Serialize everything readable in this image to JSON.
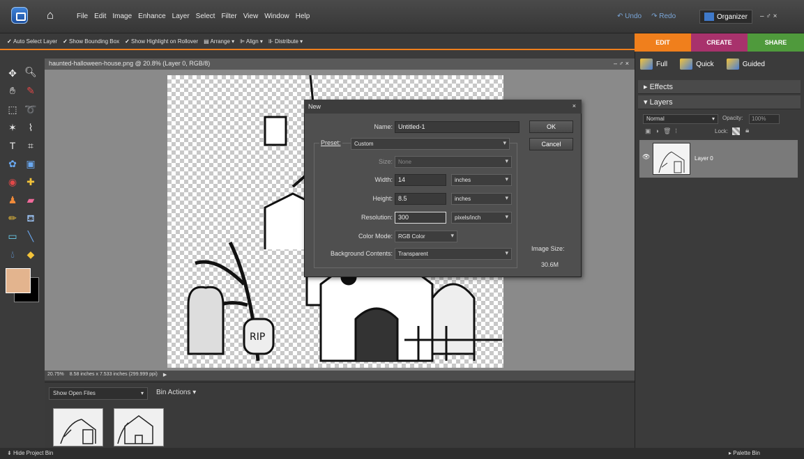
{
  "menubar": {
    "items": [
      "File",
      "Edit",
      "Image",
      "Enhance",
      "Layer",
      "Select",
      "Filter",
      "View",
      "Window",
      "Help"
    ],
    "undo": "Undo",
    "redo": "Redo",
    "organizer": "Organizer",
    "window_controls": "–  ♂  ×"
  },
  "options": {
    "auto_select": "Auto Select Layer",
    "show_bbox": "Show Bounding Box",
    "show_highlight": "Show Highlight on Rollover",
    "arrange": "Arrange",
    "align": "Align",
    "distribute": "Distribute"
  },
  "mode_tabs": {
    "edit": "EDIT",
    "create": "CREATE",
    "share": "SHARE"
  },
  "document": {
    "title": "haunted-halloween-house.png @ 20.8% (Layer 0, RGB/8)",
    "controls": "–  ♂  ×",
    "zoom": "20.75%",
    "size_info": "8.58 inches x 7.533 inches (299.999 ppi)"
  },
  "bin": {
    "show_select": "Show Open Files",
    "actions": "Bin Actions",
    "hide_project_bin": "Hide Project Bin",
    "palette_bin": "Palette Bin"
  },
  "right_panel": {
    "full": "Full",
    "quick": "Quick",
    "guided": "Guided",
    "effects": "Effects",
    "layers": "Layers",
    "blend_mode": "Normal",
    "opacity_label": "Opacity:",
    "opacity_value": "100%",
    "lock_label": "Lock:",
    "layer_name": "Layer 0"
  },
  "dialog": {
    "title": "New",
    "name_label": "Name:",
    "name_value": "Untitled-1",
    "preset_label": "Preset:",
    "preset_value": "Custom",
    "size_label": "Size:",
    "size_value": "None",
    "width_label": "Width:",
    "width_value": "14",
    "width_unit": "inches",
    "height_label": "Height:",
    "height_value": "8.5",
    "height_unit": "inches",
    "resolution_label": "Resolution:",
    "resolution_value": "300",
    "resolution_unit": "pixels/inch",
    "color_mode_label": "Color Mode:",
    "color_mode_value": "RGB Color",
    "bg_label": "Background Contents:",
    "bg_value": "Transparent",
    "ok": "OK",
    "cancel": "Cancel",
    "image_size_label": "Image Size:",
    "image_size_value": "30.6M"
  },
  "colors": {
    "foreground": "#e3b48e",
    "background": "#000000",
    "accent": "#f07f1c"
  }
}
